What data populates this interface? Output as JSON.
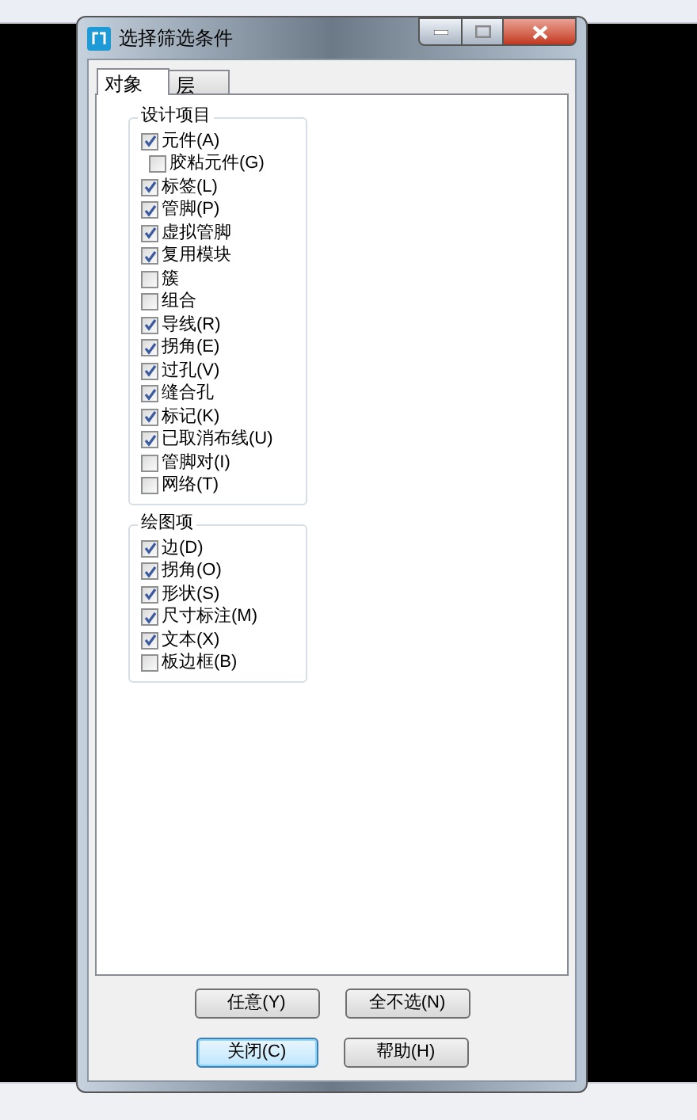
{
  "window": {
    "title": "选择筛选条件"
  },
  "tabs": [
    {
      "label": "对象",
      "selected": true
    },
    {
      "label": "层",
      "selected": false
    }
  ],
  "groups": [
    {
      "title": "设计项目",
      "items": [
        {
          "label": "元件(A)",
          "checked": true,
          "children": [
            {
              "label": "胶粘元件(G)",
              "checked": false
            }
          ]
        },
        {
          "label": "标签(L)",
          "checked": true
        },
        {
          "label": "管脚(P)",
          "checked": true
        },
        {
          "label": "虚拟管脚",
          "checked": true
        },
        {
          "label": "复用模块",
          "checked": true
        },
        {
          "label": "簇",
          "checked": false
        },
        {
          "label": "组合",
          "checked": false
        },
        {
          "label": "导线(R)",
          "checked": true
        },
        {
          "label": "拐角(E)",
          "checked": true
        },
        {
          "label": "过孔(V)",
          "checked": true
        },
        {
          "label": "缝合孔",
          "checked": true
        },
        {
          "label": "标记(K)",
          "checked": true
        },
        {
          "label": "已取消布线(U)",
          "checked": true
        },
        {
          "label": "管脚对(I)",
          "checked": false
        },
        {
          "label": "网络(T)",
          "checked": false
        }
      ]
    },
    {
      "title": "绘图项",
      "items": [
        {
          "label": "边(D)",
          "checked": true
        },
        {
          "label": "拐角(O)",
          "checked": true
        },
        {
          "label": "形状(S)",
          "checked": true
        },
        {
          "label": "尺寸标注(M)",
          "checked": true
        },
        {
          "label": "文本(X)",
          "checked": true
        },
        {
          "label": "板边框(B)",
          "checked": false
        }
      ]
    }
  ],
  "buttons": [
    [
      {
        "label": "任意(Y)",
        "focused": false
      },
      {
        "label": "全不选(N)",
        "focused": false
      }
    ],
    [
      {
        "label": "关闭(C)",
        "focused": true
      },
      {
        "label": "帮助(H)",
        "focused": false
      }
    ]
  ]
}
